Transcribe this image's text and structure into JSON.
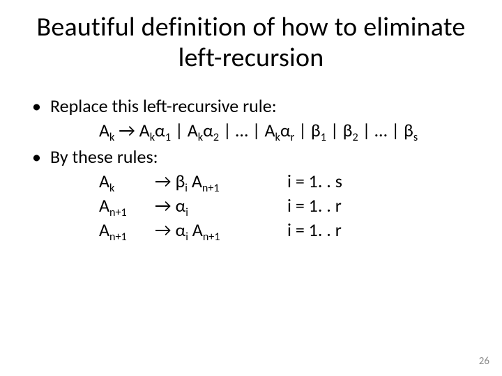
{
  "title": "Beautiful definition of how to eliminate left-recursion",
  "bullet1": "Replace this left-recursive rule:",
  "rule_original": "A<sub>k</sub> → A<sub>k</sub>α<sub>1</sub> | A<sub>k</sub>α<sub>2</sub> | … | A<sub>k</sub>α<sub>r</sub> | β<sub>1</sub> | β<sub>2</sub> | … | β<sub>s</sub>",
  "bullet2": "By these rules:",
  "rules": [
    {
      "lhs": "A<sub>k</sub>",
      "arrow": "→",
      "rhs": "β<sub>i</sub> A<sub>n+1</sub>",
      "cond": "i = 1. . s"
    },
    {
      "lhs": "A<sub>n+1</sub>",
      "arrow": "→",
      "rhs": "α<sub>i</sub>",
      "cond": "i = 1. . r"
    },
    {
      "lhs": "A<sub>n+1</sub>",
      "arrow": "→",
      "rhs": "α<sub>i</sub> A<sub>n+1</sub>",
      "cond": "i = 1. . r"
    }
  ],
  "page_number": "26"
}
